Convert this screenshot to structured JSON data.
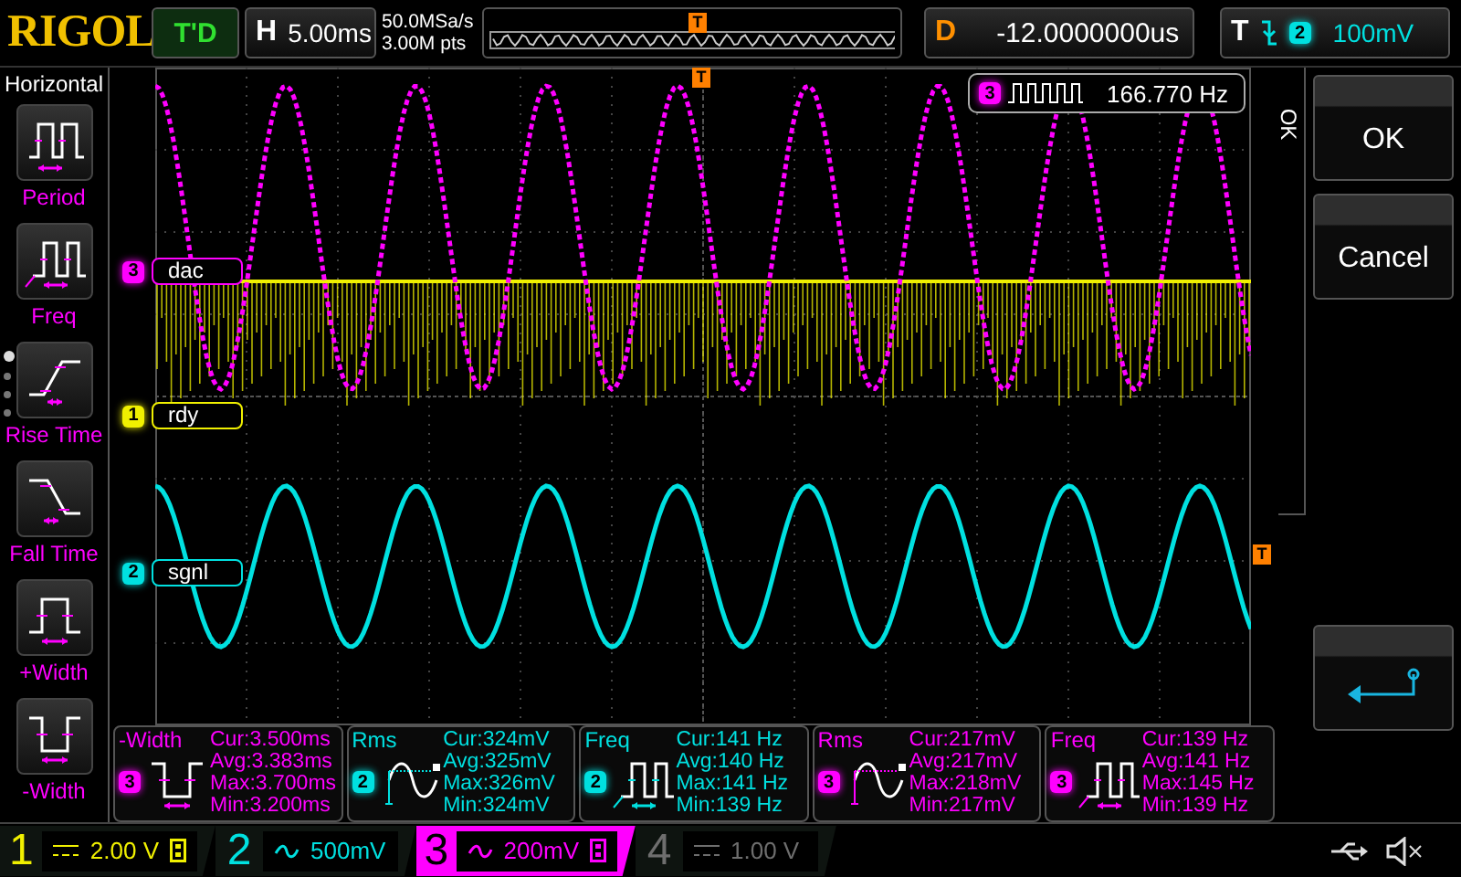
{
  "brand": "RIGOL",
  "top_bar": {
    "run_state": "T'D",
    "horizontal": {
      "label": "H",
      "value": "5.00ms"
    },
    "sample_rate": "50.0MSa/s",
    "memory_depth": "3.00M pts",
    "trigger_position_marker": "T",
    "delay": {
      "label": "D",
      "value": "-12.0000000us"
    },
    "trigger": {
      "label": "T",
      "source": "2",
      "level": "100mV"
    }
  },
  "left_menu": {
    "title": "Horizontal",
    "items": [
      {
        "label": "Period",
        "kind": "period"
      },
      {
        "label": "Freq",
        "kind": "freq"
      },
      {
        "label": "Rise Time",
        "kind": "rise"
      },
      {
        "label": "Fall Time",
        "kind": "fall"
      },
      {
        "label": "+Width",
        "kind": "pwidth"
      },
      {
        "label": "-Width",
        "kind": "nwidth"
      }
    ],
    "pages": [
      {
        "selected": true
      },
      {
        "selected": false
      },
      {
        "selected": false
      },
      {
        "selected": false
      }
    ]
  },
  "plot": {
    "trigger_top_marker": "T",
    "trigger_level_marker": "T",
    "channel_labels": [
      {
        "channel": "3",
        "name": "dac",
        "color": "#ff00ff"
      },
      {
        "channel": "1",
        "name": "rdy",
        "color": "#f0f000"
      },
      {
        "channel": "2",
        "name": "sgnl",
        "color": "#00e0e0"
      }
    ],
    "frequency_readout": {
      "channel": "3",
      "value": "166.770 Hz",
      "color": "#ff00ff"
    }
  },
  "right_menu": {
    "tab": "OK",
    "buttons": [
      {
        "label": "OK"
      },
      {
        "label": "Cancel"
      }
    ]
  },
  "measurements": [
    {
      "name": "-Width",
      "channel": "3",
      "color": "#ff00ff",
      "kind": "nwidth",
      "lines": [
        "Cur:3.500ms",
        "Avg:3.383ms",
        "Max:3.700ms",
        "Min:3.200ms"
      ]
    },
    {
      "name": "Rms",
      "channel": "2",
      "color": "#00e0e0",
      "kind": "rms",
      "lines": [
        "Cur:324mV",
        "Avg:325mV",
        "Max:326mV",
        "Min:324mV"
      ]
    },
    {
      "name": "Freq",
      "channel": "2",
      "color": "#00e0e0",
      "kind": "freq",
      "lines": [
        "Cur:141 Hz",
        "Avg:140 Hz",
        "Max:141 Hz",
        "Min:139 Hz"
      ]
    },
    {
      "name": "Rms",
      "channel": "3",
      "color": "#ff00ff",
      "kind": "rms",
      "lines": [
        "Cur:217mV",
        "Avg:217mV",
        "Max:218mV",
        "Min:217mV"
      ]
    },
    {
      "name": "Freq",
      "channel": "3",
      "color": "#ff00ff",
      "kind": "freq",
      "lines": [
        "Cur:139 Hz",
        "Avg:141 Hz",
        "Max:145 Hz",
        "Min:139 Hz"
      ]
    }
  ],
  "channels": [
    {
      "number": "1",
      "kind": "dc",
      "scale": "2.00 V",
      "bw_limit": true,
      "selected": false,
      "color": "#f0f000"
    },
    {
      "number": "2",
      "kind": "ac",
      "scale": "500mV",
      "bw_limit": false,
      "selected": false,
      "color": "#00e0e0"
    },
    {
      "number": "3",
      "kind": "ac",
      "scale": "200mV",
      "bw_limit": true,
      "selected": true,
      "color": "#ff00ff"
    },
    {
      "number": "4",
      "kind": "dc",
      "scale": "1.00 V",
      "bw_limit": false,
      "selected": false,
      "color": "#6e6e6e"
    }
  ]
}
